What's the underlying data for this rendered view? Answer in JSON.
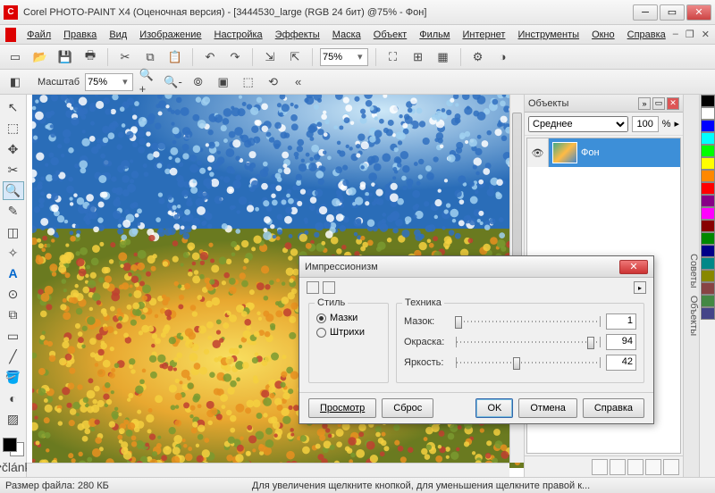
{
  "window": {
    "title": "Corel PHOTO-PAINT X4 (Оценочная версия) - [3444530_large (RGB 24 бит) @75% - Фон]"
  },
  "menu": {
    "file": "Файл",
    "edit": "Правка",
    "view": "Вид",
    "image": "Изображение",
    "adjust": "Настройка",
    "effects": "Эффекты",
    "mask": "Маска",
    "object": "Объект",
    "movie": "Фильм",
    "web": "Интернет",
    "tools": "Инструменты",
    "window": "Окно",
    "help": "Справка"
  },
  "toolbar": {
    "zoom_value": "75%"
  },
  "propbar": {
    "scale_label": "Масштаб",
    "scale_value": "75%"
  },
  "docker": {
    "title": "Объекты",
    "mode": "Среднее",
    "opacity": "100",
    "pct": "%",
    "layer_name": "Фон",
    "side_tab1": "Советы",
    "side_tab2": "Объекты"
  },
  "palette_colors": [
    "#000",
    "#fff",
    "#00f",
    "#0ff",
    "#0f0",
    "#ff0",
    "#f80",
    "#f00",
    "#808",
    "#f0f",
    "#800",
    "#080",
    "#008",
    "#088",
    "#880",
    "#844",
    "#484",
    "#448"
  ],
  "dialog": {
    "title": "Импрессионизм",
    "group_style": "Стиль",
    "radio_dabs": "Мазки",
    "radio_strokes": "Штрихи",
    "group_tech": "Техника",
    "lbl_dab": "Мазок:",
    "val_dab": "1",
    "pct_dab": 1,
    "lbl_color": "Окраска:",
    "val_color": "94",
    "pct_color": 94,
    "lbl_bright": "Яркость:",
    "val_bright": "42",
    "pct_bright": 42,
    "btn_preview": "Просмотр",
    "btn_reset": "Сброс",
    "btn_ok": "OK",
    "btn_cancel": "Отмена",
    "btn_help": "Справка"
  },
  "status": {
    "size": "Размер файла: 280 КБ",
    "hint": "Для увеличения щелкните кнопкой, для уменьшения щелкните правой к..."
  }
}
